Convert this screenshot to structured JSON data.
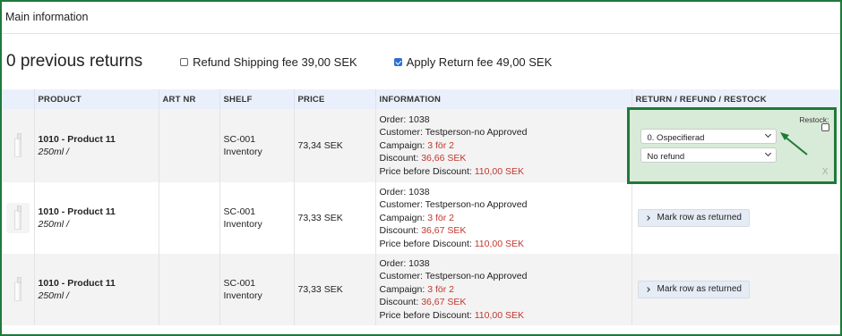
{
  "panel": {
    "title": "Main information"
  },
  "summary": {
    "previous_returns": "0 previous returns",
    "refund_shipping": {
      "label": "Refund Shipping fee 39,00 SEK",
      "checked": false
    },
    "apply_return_fee": {
      "label": "Apply Return fee 49,00 SEK",
      "checked": true
    }
  },
  "table": {
    "columns": [
      "PRODUCT",
      "ART NR",
      "SHELF",
      "PRICE",
      "INFORMATION",
      "RETURN / REFUND / RESTOCK"
    ],
    "rows": [
      {
        "product": "1010 - Product 11",
        "variant": "250ml /",
        "art_nr": "",
        "shelf_code": "SC-001",
        "shelf_name": "Inventory",
        "price": "73,34 SEK",
        "order": "Order: 1038",
        "customer": "Customer: Testperson-no Approved",
        "campaign_label": "Campaign:",
        "campaign": "3 för 2",
        "discount_label": "Discount:",
        "discount": "36,66 SEK",
        "price_before_label": "Price before Discount:",
        "price_before": "110,00 SEK"
      },
      {
        "product": "1010 - Product 11",
        "variant": "250ml /",
        "art_nr": "",
        "shelf_code": "SC-001",
        "shelf_name": "Inventory",
        "price": "73,33 SEK",
        "order": "Order: 1038",
        "customer": "Customer: Testperson-no Approved",
        "campaign_label": "Campaign:",
        "campaign": "3 för 2",
        "discount_label": "Discount:",
        "discount": "36,67 SEK",
        "price_before_label": "Price before Discount:",
        "price_before": "110,00 SEK",
        "action": "Mark row as returned"
      },
      {
        "product": "1010 - Product 11",
        "variant": "250ml /",
        "art_nr": "",
        "shelf_code": "SC-001",
        "shelf_name": "Inventory",
        "price": "73,33 SEK",
        "order": "Order: 1038",
        "customer": "Customer: Testperson-no Approved",
        "campaign_label": "Campaign:",
        "campaign": "3 för 2",
        "discount_label": "Discount:",
        "discount": "36,67 SEK",
        "price_before_label": "Price before Discount:",
        "price_before": "110,00 SEK",
        "action": "Mark row as returned"
      }
    ]
  },
  "return_editor": {
    "restock_label": "Restock:",
    "restock_checked": false,
    "reason_select": "0. Ospecifierad",
    "refund_select": "No refund",
    "close": "X"
  },
  "colors": {
    "highlight_border": "#1f7a3a",
    "highlight_fill": "#d8ebd8",
    "accent_red": "#c2372f",
    "header_bg": "#eaf0fb",
    "checkbox_blue": "#2a6fd6"
  },
  "icons": {
    "bottle": "product-bottle-icon",
    "chevron_down": "chevron-down-icon",
    "chevron_right": "chevron-right-icon",
    "arrow": "pointer-arrow-icon"
  }
}
